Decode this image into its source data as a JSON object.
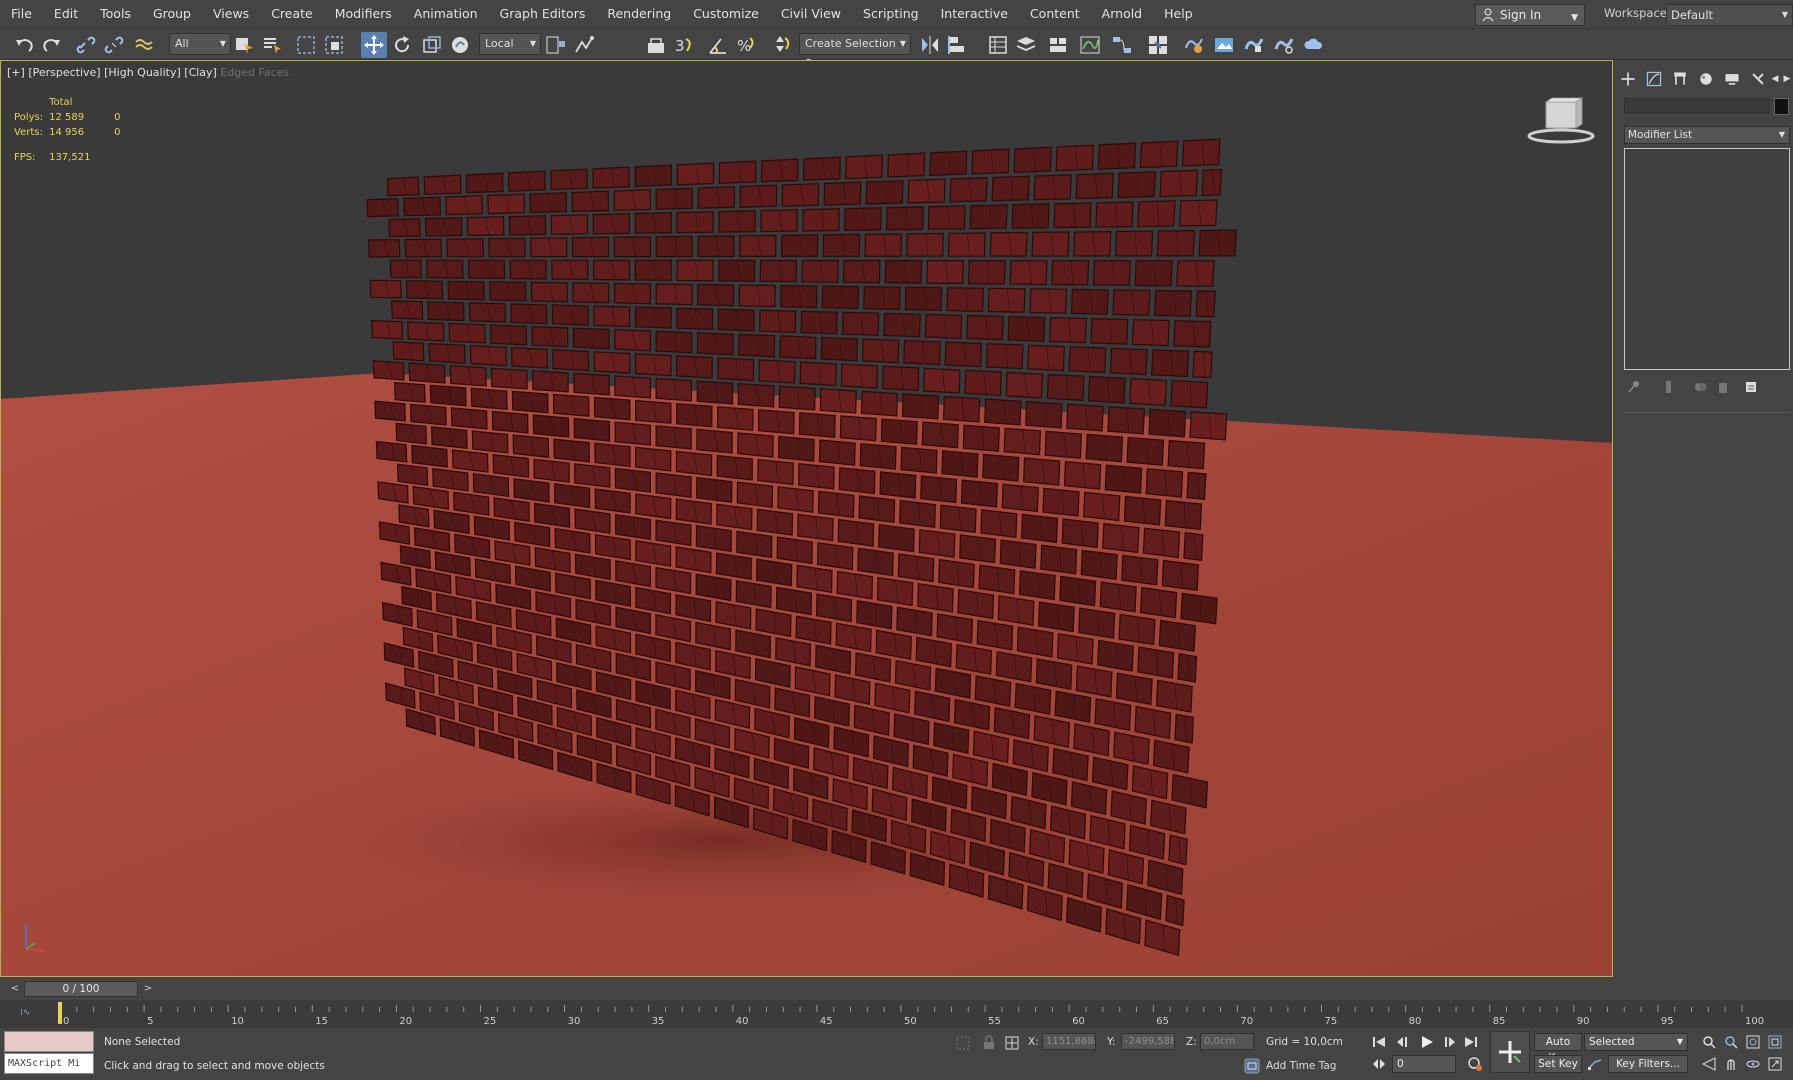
{
  "menubar": {
    "items": [
      "File",
      "Edit",
      "Tools",
      "Group",
      "Views",
      "Create",
      "Modifiers",
      "Animation",
      "Graph Editors",
      "Rendering",
      "Customize",
      "Civil View",
      "Scripting",
      "Interactive",
      "Content",
      "Arnold",
      "Help"
    ],
    "sign_in": "Sign In",
    "workspaces_label": "Workspaces:",
    "workspace_value": "Default"
  },
  "toolbar": {
    "selection_filter": "All",
    "ref_coord": "Local",
    "named_selection": "Create Selection Se",
    "icons": [
      "undo-icon",
      "redo-icon",
      "link-icon",
      "unlink-icon",
      "bind-space-warp-icon",
      "select-object-icon",
      "select-by-name-icon",
      "rect-selection-icon",
      "window-crossing-icon",
      "select-move-icon",
      "select-rotate-icon",
      "select-scale-icon",
      "select-place-icon",
      "pivot-icon",
      "select-manipulate-icon",
      "keyboard-shortcut-icon",
      "snap-3d-icon",
      "angle-snap-icon",
      "percent-snap-icon",
      "spinner-snap-icon",
      "edit-named-sets-icon",
      "mirror-icon",
      "align-icon",
      "scene-explorer-icon",
      "layer-explorer-icon",
      "ribbon-icon",
      "curve-editor-icon",
      "schematic-view-icon",
      "material-editor-icon",
      "render-setup-icon",
      "render-frame-icon",
      "render-icon",
      "render-iterative-icon",
      "render-cloud-icon"
    ]
  },
  "viewport": {
    "label_parts": [
      "[+]",
      "[Perspective]",
      "[High Quality]",
      "[Clay]"
    ],
    "label_dim": "Edged Faces",
    "stats": {
      "total_label": "Total",
      "polys_label": "Polys:",
      "polys_total": "12 589",
      "polys_sel": "0",
      "verts_label": "Verts:",
      "verts_total": "14 956",
      "verts_sel": "0",
      "fps_label": "FPS:",
      "fps_value": "137,521"
    },
    "colors": {
      "floor": "#a44a3f",
      "background": "#3a3a3a",
      "brick": "#5b1b1a",
      "brick_edge": "#2d0a0a"
    }
  },
  "command_panel": {
    "modifier_list": "Modifier List",
    "tabs": [
      "create-tab-icon",
      "modify-tab-icon",
      "hierarchy-tab-icon",
      "motion-tab-icon",
      "display-tab-icon",
      "utilities-tab-icon"
    ]
  },
  "timeline": {
    "frame_display": "0 / 100",
    "prev": "<",
    "next": ">",
    "ticks": [
      "0",
      "5",
      "10",
      "15",
      "20",
      "25",
      "30",
      "35",
      "40",
      "45",
      "50",
      "55",
      "60",
      "65",
      "70",
      "75",
      "80",
      "85",
      "90",
      "95",
      "100"
    ]
  },
  "statusbar": {
    "maxscript": "MAXScript Mi",
    "selection": "None Selected",
    "prompt": "Click and drag to select and move objects",
    "x_label": "X:",
    "x_value": "1151,868cı",
    "y_label": "Y:",
    "y_value": "-2499,588c",
    "z_label": "Z:",
    "z_value": "0,0cm",
    "grid": "Grid = 10,0cm",
    "add_time_tag": "Add Time Tag",
    "auto_key": "Auto Key",
    "set_key": "Set Key",
    "selected": "Selected",
    "key_filters": "Key Filters...",
    "frame": "0"
  }
}
